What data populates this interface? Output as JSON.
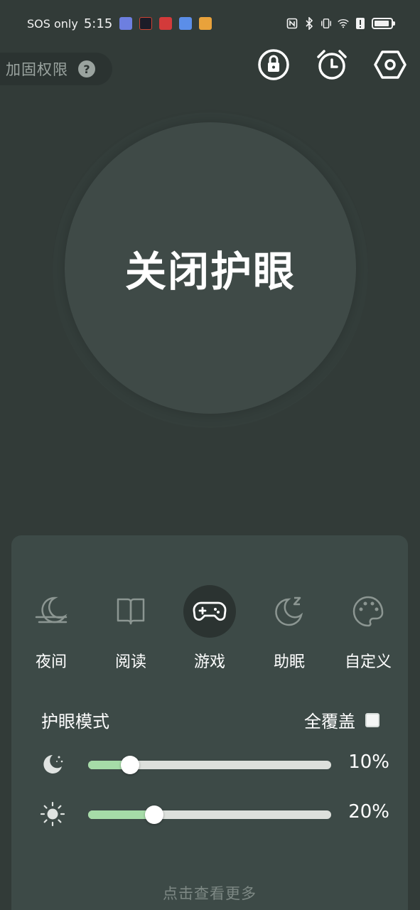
{
  "status_bar": {
    "carrier": "SOS only",
    "time": "5:15",
    "battery_level": 0.9
  },
  "header": {
    "permission_label": "加固权限",
    "help_symbol": "?",
    "icons": [
      "lock-icon",
      "alarm-clock-icon",
      "settings-icon"
    ]
  },
  "main": {
    "toggle_label": "关闭护眼"
  },
  "panel": {
    "modes": [
      {
        "label": "夜间",
        "icon": "night-moon-icon",
        "active": false
      },
      {
        "label": "阅读",
        "icon": "book-icon",
        "active": false
      },
      {
        "label": "游戏",
        "icon": "gamepad-icon",
        "active": true
      },
      {
        "label": "助眠",
        "icon": "sleep-moon-icon",
        "active": false
      },
      {
        "label": "自定义",
        "icon": "palette-icon",
        "active": false
      }
    ],
    "mode_title": "护眼模式",
    "cover_label": "全覆盖",
    "cover_checked": false,
    "sliders": [
      {
        "icon": "moon-icon",
        "value": 10,
        "display": "10%"
      },
      {
        "icon": "brightness-icon",
        "value": 20,
        "display": "20%"
      }
    ],
    "more_label": "点击查看更多"
  },
  "colors": {
    "background": "#323b38",
    "panel": "#3d4a47",
    "circle": "#3f4a47",
    "slider_fill": "#a6dca8",
    "slider_track": "#dde0dc"
  }
}
